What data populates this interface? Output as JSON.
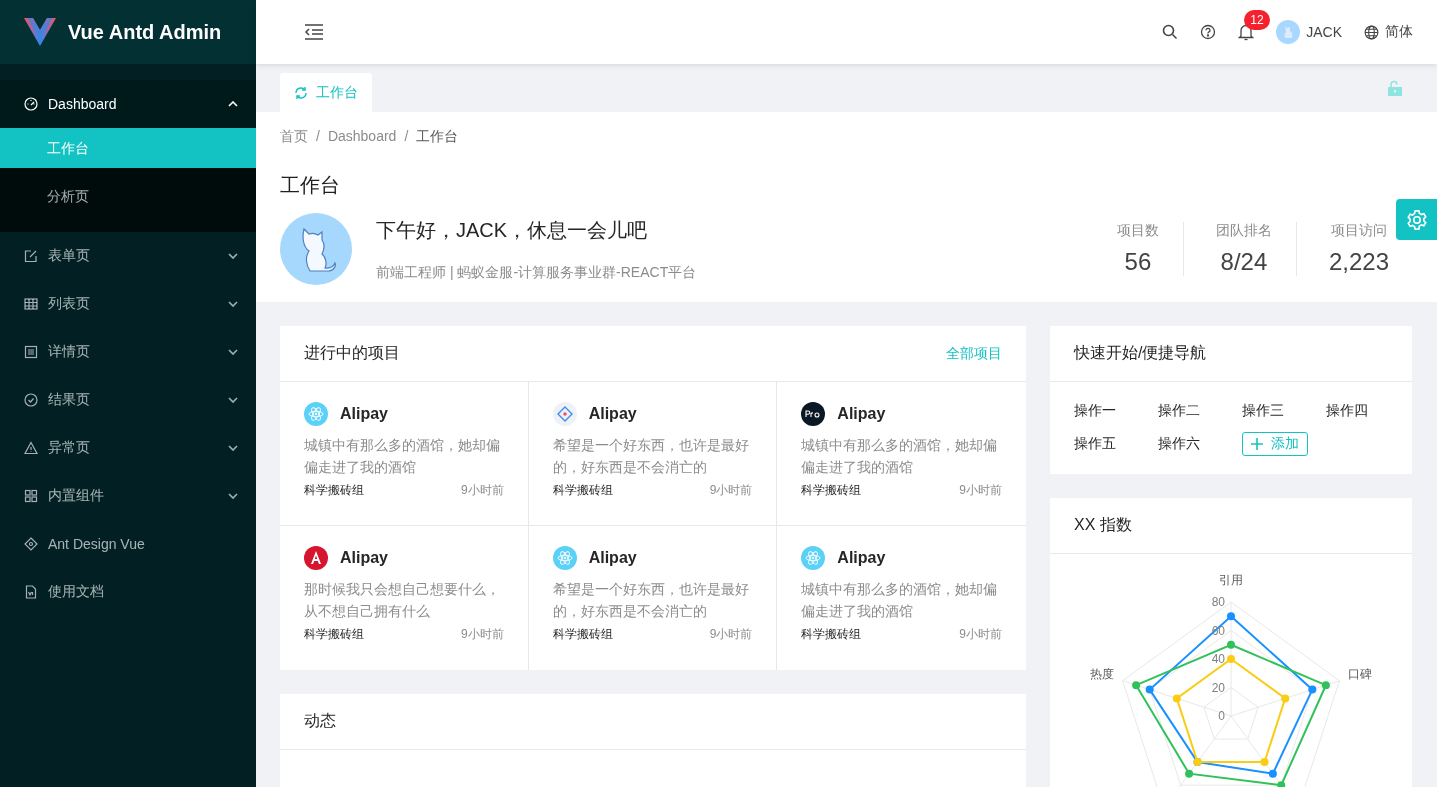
{
  "app": {
    "title": "Vue Antd Admin"
  },
  "sidebar": {
    "items": [
      {
        "label": "Dashboard",
        "kind": "dashboard",
        "expanded": true,
        "children": [
          {
            "label": "工作台",
            "selected": true
          },
          {
            "label": "分析页",
            "selected": false
          }
        ]
      },
      {
        "label": "表单页",
        "kind": "form",
        "expanded": false
      },
      {
        "label": "列表页",
        "kind": "table",
        "expanded": false
      },
      {
        "label": "详情页",
        "kind": "profile",
        "expanded": false
      },
      {
        "label": "结果页",
        "kind": "check",
        "expanded": false
      },
      {
        "label": "异常页",
        "kind": "warning",
        "expanded": false
      },
      {
        "label": "内置组件",
        "kind": "appstore",
        "expanded": false
      },
      {
        "label": "Ant Design Vue",
        "kind": "antd"
      },
      {
        "label": "使用文档",
        "kind": "file"
      }
    ]
  },
  "header": {
    "notification_count": "12",
    "user": "JACK",
    "language": "简体"
  },
  "tabs": [
    {
      "label": "工作台",
      "selected": true
    }
  ],
  "breadcrumb": {
    "separator": "/",
    "items": [
      "首页",
      "Dashboard",
      "工作台"
    ]
  },
  "page_title": "工作台",
  "profile": {
    "greeting": "下午好，JACK，休息一会儿吧",
    "subtitle": "前端工程师 | 蚂蚁金服-计算服务事业群-REACT平台"
  },
  "stats": [
    {
      "label": "项目数",
      "value": "56"
    },
    {
      "label": "团队排名",
      "value": "8/24"
    },
    {
      "label": "项目访问",
      "value": "2,223"
    }
  ],
  "projects": {
    "title": "进行中的项目",
    "link": "全部项目",
    "items": [
      {
        "kind": "react",
        "name": "Alipay",
        "desc": "城镇中有那么多的酒馆，她却偏偏走进了我的酒馆",
        "group": "科学搬砖组",
        "time": "9小时前"
      },
      {
        "kind": "antd",
        "name": "Alipay",
        "desc": "希望是一个好东西，也许是最好的，好东西是不会消亡的",
        "group": "科学搬砖组",
        "time": "9小时前"
      },
      {
        "kind": "pro",
        "name": "Alipay",
        "desc": "城镇中有那么多的酒馆，她却偏偏走进了我的酒馆",
        "group": "科学搬砖组",
        "time": "9小时前"
      },
      {
        "kind": "angular",
        "name": "Alipay",
        "desc": "那时候我只会想自己想要什么，从不想自己拥有什么",
        "group": "科学搬砖组",
        "time": "9小时前"
      },
      {
        "kind": "react",
        "name": "Alipay",
        "desc": "希望是一个好东西，也许是最好的，好东西是不会消亡的",
        "group": "科学搬砖组",
        "time": "9小时前"
      },
      {
        "kind": "react",
        "name": "Alipay",
        "desc": "城镇中有那么多的酒馆，她却偏偏走进了我的酒馆",
        "group": "科学搬砖组",
        "time": "9小时前"
      }
    ]
  },
  "activity": {
    "title": "动态"
  },
  "quick_nav": {
    "title": "快速开始/便捷导航",
    "actions": [
      "操作一",
      "操作二",
      "操作三",
      "操作四",
      "操作五",
      "操作六"
    ],
    "add_button": "添加"
  },
  "index_card": {
    "title": "XX 指数",
    "axis_labels": [
      {
        "kind": "top",
        "text": "引用"
      },
      {
        "kind": "right",
        "text": "口碑"
      },
      {
        "kind": "left",
        "text": "热度"
      }
    ],
    "ticks": [
      "80",
      "60",
      "40",
      "20",
      "0"
    ]
  }
}
